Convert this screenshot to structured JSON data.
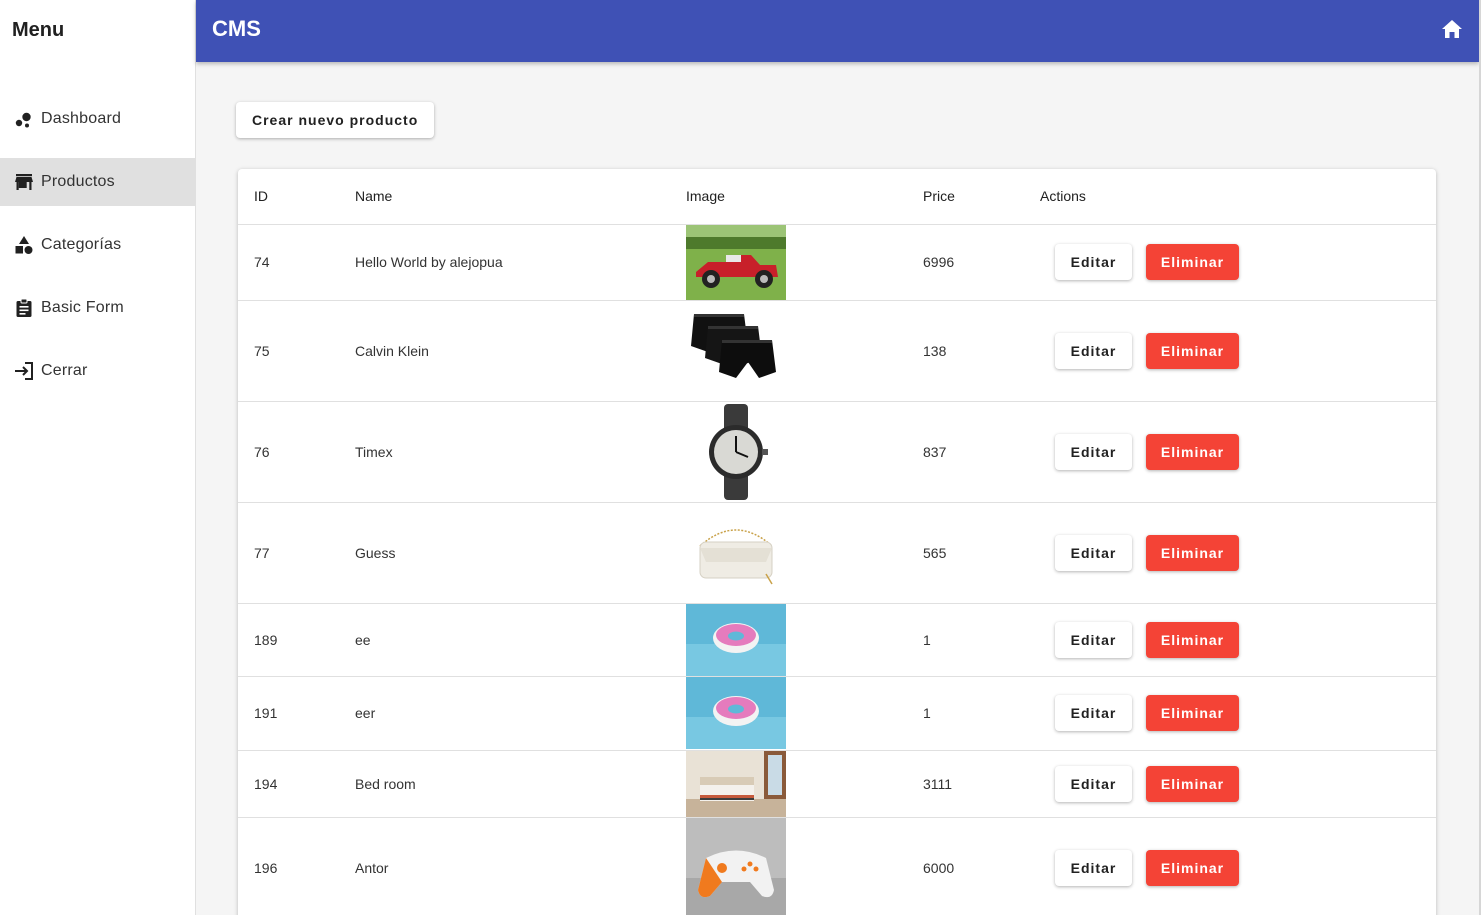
{
  "sidebar": {
    "title": "Menu",
    "items": [
      {
        "label": "Dashboard",
        "icon": "bubble-chart-icon",
        "active": false
      },
      {
        "label": "Productos",
        "icon": "store-icon",
        "active": true
      },
      {
        "label": "Categorías",
        "icon": "category-shapes-icon",
        "active": false
      },
      {
        "label": "Basic Form",
        "icon": "clipboard-icon",
        "active": false
      },
      {
        "label": "Cerrar",
        "icon": "logout-icon",
        "active": false
      }
    ]
  },
  "appbar": {
    "title": "CMS",
    "home_icon": "home-icon",
    "color": "#3f51b5"
  },
  "toolbar": {
    "create_label": "Crear nuevo producto"
  },
  "table": {
    "headers": {
      "id": "ID",
      "name": "Name",
      "image": "Image",
      "price": "Price",
      "actions": "Actions"
    },
    "edit_label": "Editar",
    "delete_label": "Eliminar",
    "delete_color": "#f44336",
    "rows": [
      {
        "id": "74",
        "name": "Hello World by alejopua",
        "price": "6996",
        "image": "red-vintage-car"
      },
      {
        "id": "75",
        "name": "Calvin Klein",
        "price": "138",
        "image": "black-boxer-briefs"
      },
      {
        "id": "76",
        "name": "Timex",
        "price": "837",
        "image": "wristwatch"
      },
      {
        "id": "77",
        "name": "Guess",
        "price": "565",
        "image": "white-handbag"
      },
      {
        "id": "189",
        "name": "ee",
        "price": "1",
        "image": "donut-pool-float"
      },
      {
        "id": "191",
        "name": "eer",
        "price": "1",
        "image": "donut-pool-float"
      },
      {
        "id": "194",
        "name": "Bed room",
        "price": "3111",
        "image": "bedroom"
      },
      {
        "id": "196",
        "name": "Antor",
        "price": "6000",
        "image": "game-controller"
      }
    ]
  }
}
